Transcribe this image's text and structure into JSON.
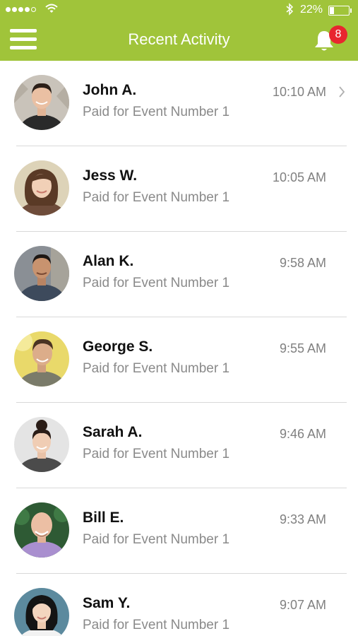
{
  "status_bar": {
    "battery_percent": "22%",
    "signal_bars_filled": 4,
    "signal_bars_total": 5
  },
  "header": {
    "title": "Recent Activity",
    "notification_count": "8",
    "accent_color": "#a0c43a",
    "badge_color": "#e8262f"
  },
  "activity": [
    {
      "name": "John A.",
      "detail": "Paid for Event Number 1",
      "time": "10:10 AM",
      "chevron": true
    },
    {
      "name": "Jess W.",
      "detail": "Paid for Event Number 1",
      "time": "10:05 AM",
      "chevron": false
    },
    {
      "name": "Alan K.",
      "detail": "Paid for Event Number 1",
      "time": "9:58 AM",
      "chevron": false
    },
    {
      "name": "George S.",
      "detail": "Paid for Event Number 1",
      "time": "9:55 AM",
      "chevron": false
    },
    {
      "name": "Sarah A.",
      "detail": "Paid for Event Number 1",
      "time": "9:46 AM",
      "chevron": false
    },
    {
      "name": "Bill E.",
      "detail": "Paid for Event Number 1",
      "time": "9:33 AM",
      "chevron": false
    },
    {
      "name": "Sam Y.",
      "detail": "Paid for Event Number 1",
      "time": "9:07 AM",
      "chevron": false
    }
  ]
}
